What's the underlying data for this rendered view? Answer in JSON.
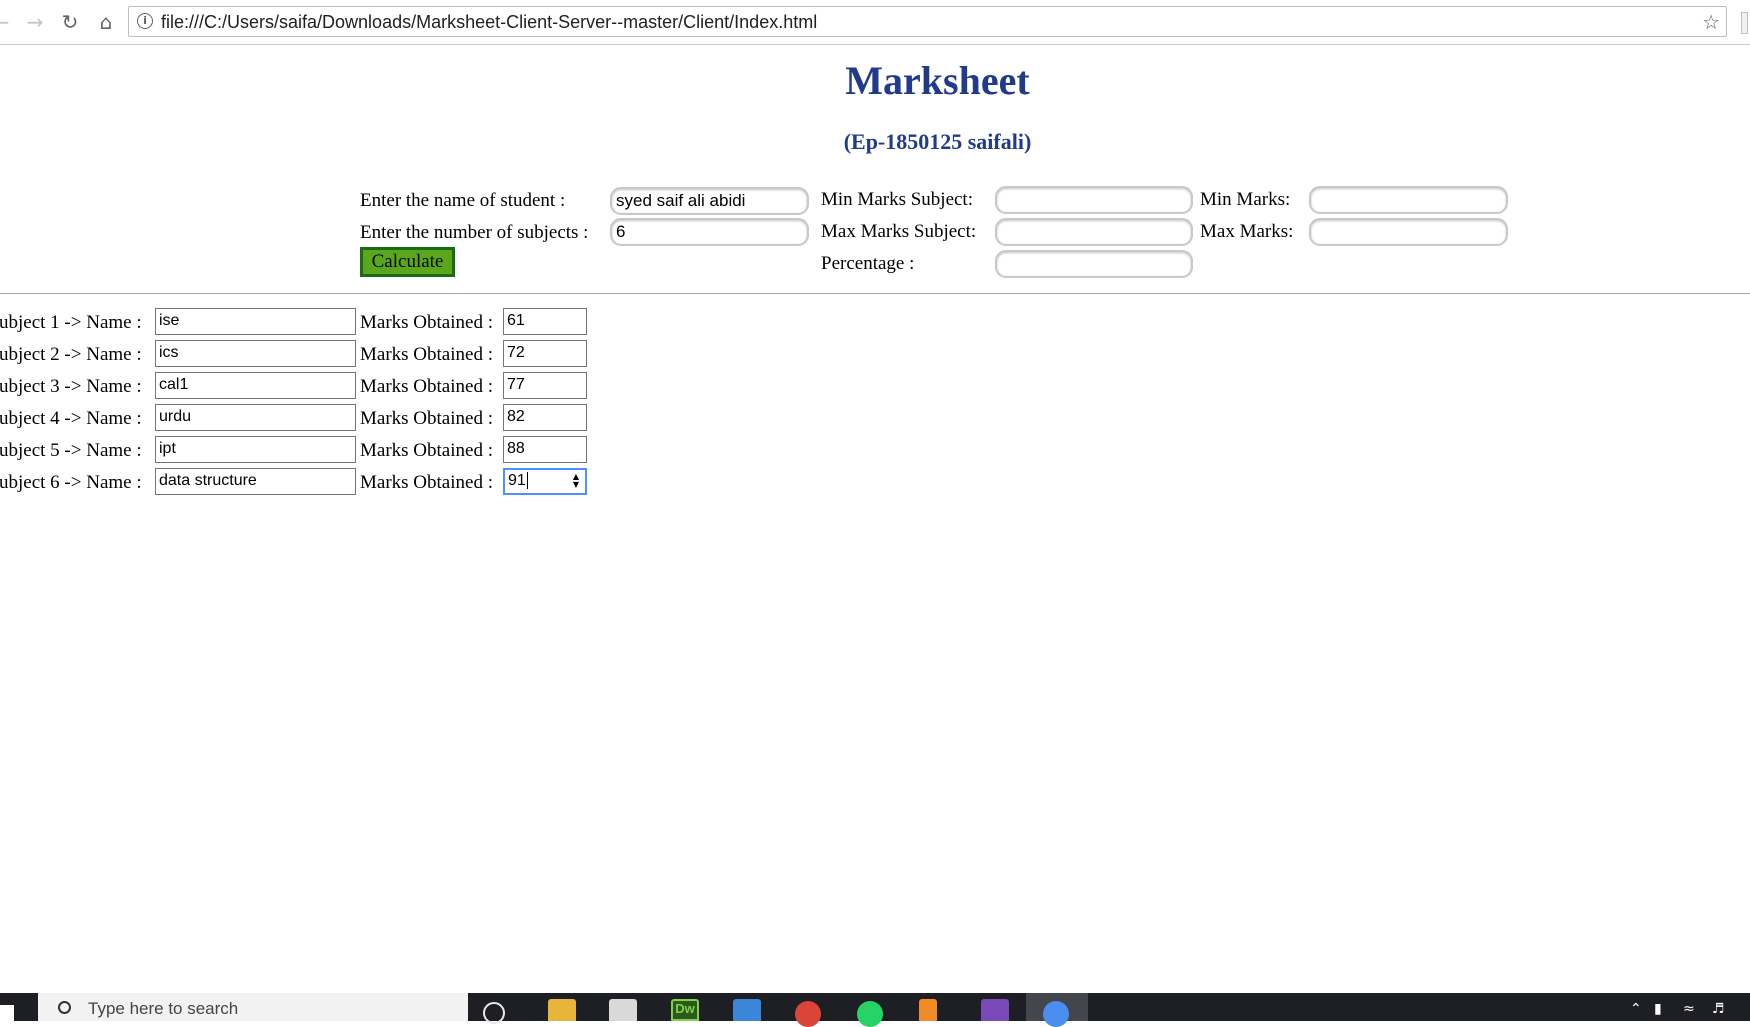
{
  "browser": {
    "url": "file:///C:/Users/saifa/Downloads/Marksheet-Client-Server--master/Client/Index.html"
  },
  "page": {
    "title": "Marksheet",
    "subtitle": "(Ep-1850125 saifali)"
  },
  "form": {
    "name_label": "Enter the name of student :",
    "name_value": "syed saif ali abidi",
    "subjects_label": "Enter the number of subjects :",
    "subjects_value": "6",
    "calculate_label": "Calculate",
    "min_subject_label": "Min Marks Subject:",
    "min_subject_value": "",
    "min_marks_label": "Min Marks:",
    "min_marks_value": "",
    "max_subject_label": "Max Marks Subject:",
    "max_subject_value": "",
    "max_marks_label": "Max Marks:",
    "max_marks_value": "",
    "percentage_label": "Percentage :",
    "percentage_value": ""
  },
  "subjects": [
    {
      "label": "ubject 1 -> Name :",
      "name": "ise",
      "marks_label": "Marks Obtained :",
      "marks": "61"
    },
    {
      "label": "ubject 2 -> Name :",
      "name": "ics",
      "marks_label": "Marks Obtained :",
      "marks": "72"
    },
    {
      "label": "ubject 3 -> Name :",
      "name": "cal1",
      "marks_label": "Marks Obtained :",
      "marks": "77"
    },
    {
      "label": "ubject 4 -> Name :",
      "name": "urdu",
      "marks_label": "Marks Obtained :",
      "marks": "82"
    },
    {
      "label": "ubject 5 -> Name :",
      "name": "ipt",
      "marks_label": "Marks Obtained :",
      "marks": "88"
    },
    {
      "label": "ubject 6 -> Name :",
      "name": "data structure",
      "marks_label": "Marks Obtained :",
      "marks": "91"
    }
  ],
  "taskbar": {
    "search_placeholder": "Type here to search",
    "icons": [
      "search-icon",
      "file-explorer-icon",
      "store-icon",
      "dreamweaver-icon",
      "photos-icon",
      "chrome-icon",
      "whatsapp-icon",
      "sublime-icon",
      "visual-studio-icon",
      "chrome-active-icon"
    ]
  },
  "colors": {
    "heading": "#1f3b8a",
    "calculate_button": "#5aa61d",
    "calculate_border": "#1d6a16",
    "focus_ring": "#4d90fe",
    "taskbar": "#1e1f24"
  }
}
